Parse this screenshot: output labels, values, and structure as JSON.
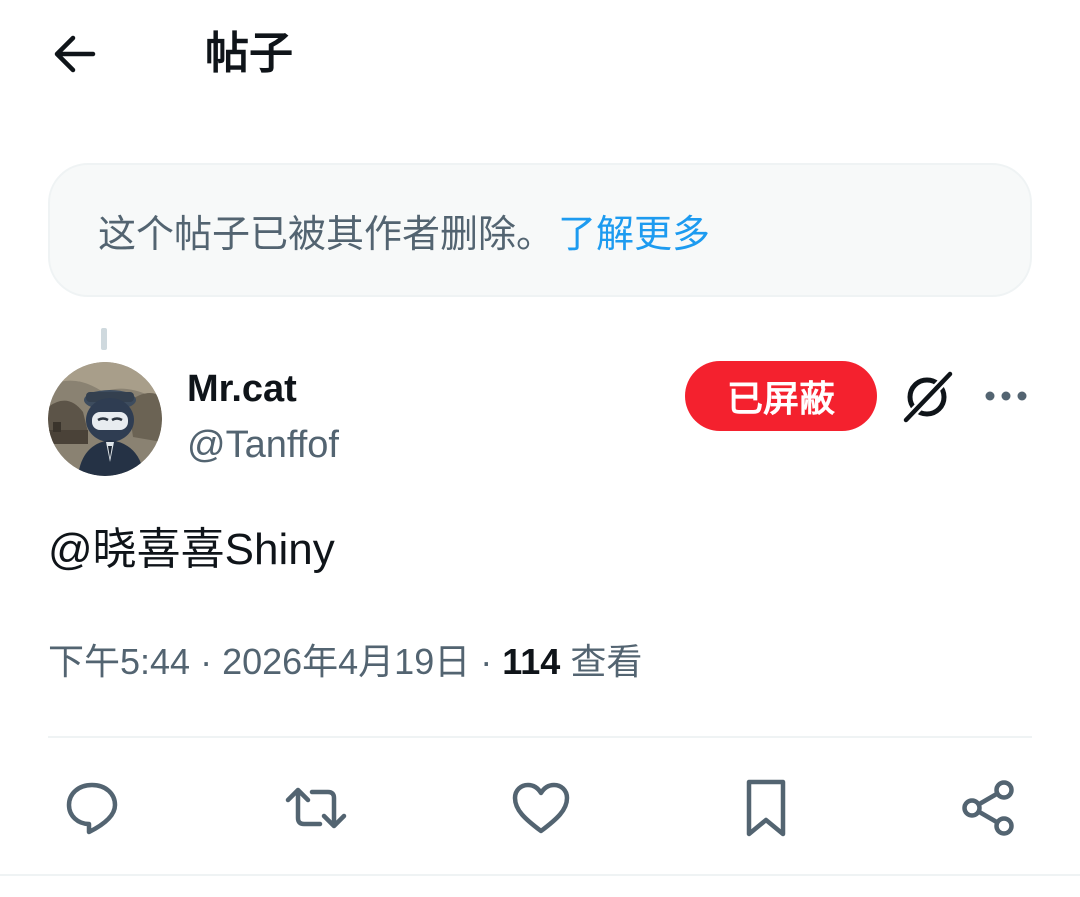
{
  "header": {
    "title": "帖子",
    "back_icon": "arrow-left-icon"
  },
  "notice": {
    "text": "这个帖子已被其作者删除。",
    "learn_more": "了解更多",
    "link_color": "#1d9bf0"
  },
  "author": {
    "display_name": "Mr.cat",
    "handle": "@Tanffof",
    "avatar_icon": "avatar-image"
  },
  "actions_top": {
    "blocked_label": "已屏蔽",
    "blocked_color": "#f4212e",
    "grok_icon": "grok-icon",
    "more_icon": "more-horizontal-icon"
  },
  "post": {
    "text": "@晓喜喜Shiny"
  },
  "meta": {
    "time": "下午5:44",
    "sep1": " · ",
    "date": "2026年4月19日",
    "sep2": " · ",
    "views_count": "114",
    "views_label": " 查看"
  },
  "action_bar": [
    {
      "icon": "reply-icon"
    },
    {
      "icon": "repost-icon"
    },
    {
      "icon": "like-icon"
    },
    {
      "icon": "bookmark-icon"
    },
    {
      "icon": "share-icon"
    }
  ]
}
